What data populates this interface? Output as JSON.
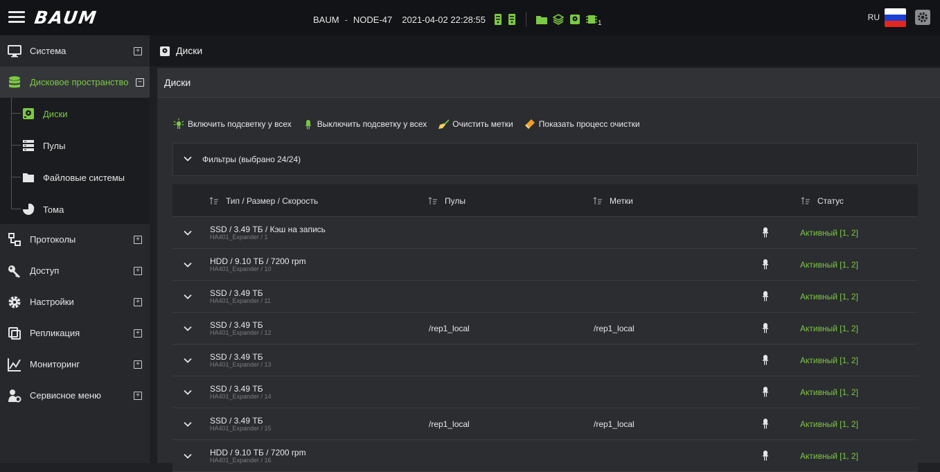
{
  "header": {
    "logo": "BAUM",
    "company": "BAUM",
    "separator": "-",
    "node": "NODE-47",
    "datetime": "2021-04-02 22:28:55",
    "chip_badge": "1",
    "lang": "RU",
    "accent": "#7cc943"
  },
  "sidebar": {
    "items": [
      {
        "label": "Система",
        "icon": "monitor-icon",
        "toggle": "+"
      },
      {
        "label": "Дисковое пространство",
        "icon": "database-icon",
        "toggle": "−"
      },
      {
        "label": "Протоколы",
        "icon": "network-icon",
        "toggle": "+"
      },
      {
        "label": "Доступ",
        "icon": "key-icon",
        "toggle": "+"
      },
      {
        "label": "Настройки",
        "icon": "gear-icon",
        "toggle": "+"
      },
      {
        "label": "Репликация",
        "icon": "copy-icon",
        "toggle": "+"
      },
      {
        "label": "Мониторинг",
        "icon": "chart-icon",
        "toggle": "+"
      },
      {
        "label": "Сервисное меню",
        "icon": "user-gear-icon",
        "toggle": "+"
      }
    ],
    "subitems": [
      {
        "label": "Диски",
        "icon": "disk-icon"
      },
      {
        "label": "Пулы",
        "icon": "pool-icon"
      },
      {
        "label": "Файловые системы",
        "icon": "folder-icon"
      },
      {
        "label": "Тома",
        "icon": "pie-icon"
      }
    ]
  },
  "page": {
    "title": "Диски",
    "panel_title": "Диски",
    "actions": [
      {
        "label": "Включить подсветку у всех",
        "icon": "led-on-icon"
      },
      {
        "label": "Выключить подсветку у всех",
        "icon": "led-off-icon"
      },
      {
        "label": "Очистить метки",
        "icon": "broom-icon"
      },
      {
        "label": "Показать процесс очистки",
        "icon": "eraser-icon"
      }
    ],
    "filters_label": "Фильтры (выбрано 24/24)"
  },
  "table": {
    "columns": [
      "Тип / Размер / Скорость",
      "Пулы",
      "Метки",
      "Статус"
    ],
    "rows": [
      {
        "type": "SSD / 3.49 ТБ / Кэш на запись",
        "location": "HA401_Expander / 1",
        "pool": "",
        "mark": "",
        "status": "Активный [1, 2]"
      },
      {
        "type": "HDD / 9.10 ТБ / 7200 rpm",
        "location": "HA401_Expander / 10",
        "pool": "",
        "mark": "",
        "status": "Активный [1, 2]"
      },
      {
        "type": "SSD / 3.49 ТБ",
        "location": "HA401_Expander / 11",
        "pool": "",
        "mark": "",
        "status": "Активный [1, 2]"
      },
      {
        "type": "SSD / 3.49 ТБ",
        "location": "HA401_Expander / 12",
        "pool": "/rep1_local",
        "mark": "/rep1_local",
        "status": "Активный [1, 2]"
      },
      {
        "type": "SSD / 3.49 ТБ",
        "location": "HA401_Expander / 13",
        "pool": "",
        "mark": "",
        "status": "Активный [1, 2]"
      },
      {
        "type": "SSD / 3.49 ТБ",
        "location": "HA401_Expander / 14",
        "pool": "",
        "mark": "",
        "status": "Активный [1, 2]"
      },
      {
        "type": "SSD / 3.49 ТБ",
        "location": "HA401_Expander / 15",
        "pool": "/rep1_local",
        "mark": "/rep1_local",
        "status": "Активный [1, 2]"
      },
      {
        "type": "HDD / 9.10 ТБ / 7200 rpm",
        "location": "HA401_Expander / 16",
        "pool": "",
        "mark": "",
        "status": "Активный [1, 2]"
      }
    ]
  }
}
